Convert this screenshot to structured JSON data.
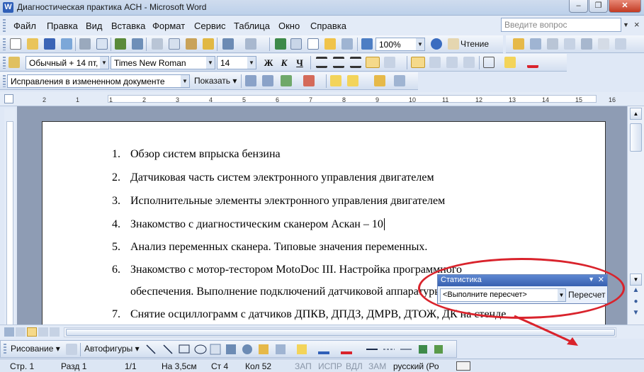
{
  "window": {
    "title": "Диагностическая практика АСН - Microsoft Word",
    "app_icon": "W"
  },
  "window_buttons": {
    "minimize": "–",
    "restore": "❐",
    "close": "✕"
  },
  "menu": {
    "items": [
      "Файл",
      "Правка",
      "Вид",
      "Вставка",
      "Формат",
      "Сервис",
      "Таблица",
      "Окно",
      "Справка"
    ],
    "ask_placeholder": "Введите вопрос",
    "close_doc": "×"
  },
  "standard_toolbar": {
    "zoom": "100%",
    "reading_label": "Чтение"
  },
  "formatting_toolbar": {
    "style": "Обычный + 14 пт,",
    "font": "Times New Roman",
    "size": "14",
    "bold": "Ж",
    "italic": "К",
    "underline": "Ч"
  },
  "review_toolbar": {
    "mode": "Исправления в измененном документе",
    "show_label": "Показать"
  },
  "ruler": {
    "marks": [
      "2",
      "1",
      "1",
      "2",
      "3",
      "4",
      "5",
      "6",
      "7",
      "8",
      "9",
      "10",
      "11",
      "12",
      "13",
      "14",
      "15",
      "16"
    ]
  },
  "document": {
    "items": [
      {
        "num": "1.",
        "text": "Обзор систем впрыска бензина"
      },
      {
        "num": "2.",
        "text": "Датчиковая часть систем электронного управления двигателем"
      },
      {
        "num": "3.",
        "text": "Исполнительные элементы электронного управления двигателем"
      },
      {
        "num": "4.",
        "text": "Знакомство с диагностическим сканером Аскан – 10"
      },
      {
        "num": "5.",
        "text": "Анализ переменных  сканера. Типовые значения переменных."
      },
      {
        "num": "6.",
        "text": "Знакомство    с    мотор-тестором    MotoDoc    III.    Настройка    программного"
      },
      {
        "num": "",
        "text": "обеспечения. Выполнение подключений датчиковой аппаратуры."
      },
      {
        "num": "7.",
        "text": "Снятие осциллограмм с  датчиков ДПКВ, ДПДЗ, ДМРВ, ДТОЖ, ДК на стенде"
      }
    ]
  },
  "stats_panel": {
    "title": "Статистика",
    "combo_value": "<Выполните пересчет>",
    "recount_button": "Пересчет"
  },
  "drawing_toolbar": {
    "draw_label": "Рисование",
    "autoshapes_label": "Автофигуры"
  },
  "status_bar": {
    "page": "Стр. 1",
    "section": "Разд 1",
    "page_count": "1/1",
    "position": "На 3,5см",
    "line": "Ст 4",
    "column": "Кол 52",
    "rec": "ЗАП",
    "trk": "ИСПР",
    "ext": "ВДЛ",
    "ovr": "ЗАМ",
    "language": "русский (Ро"
  },
  "colors": {
    "annotation_red": "#d9232c",
    "titlebar": "#bcd0ea",
    "highlight": "#f3d45a",
    "font_color": "#d9232c"
  }
}
